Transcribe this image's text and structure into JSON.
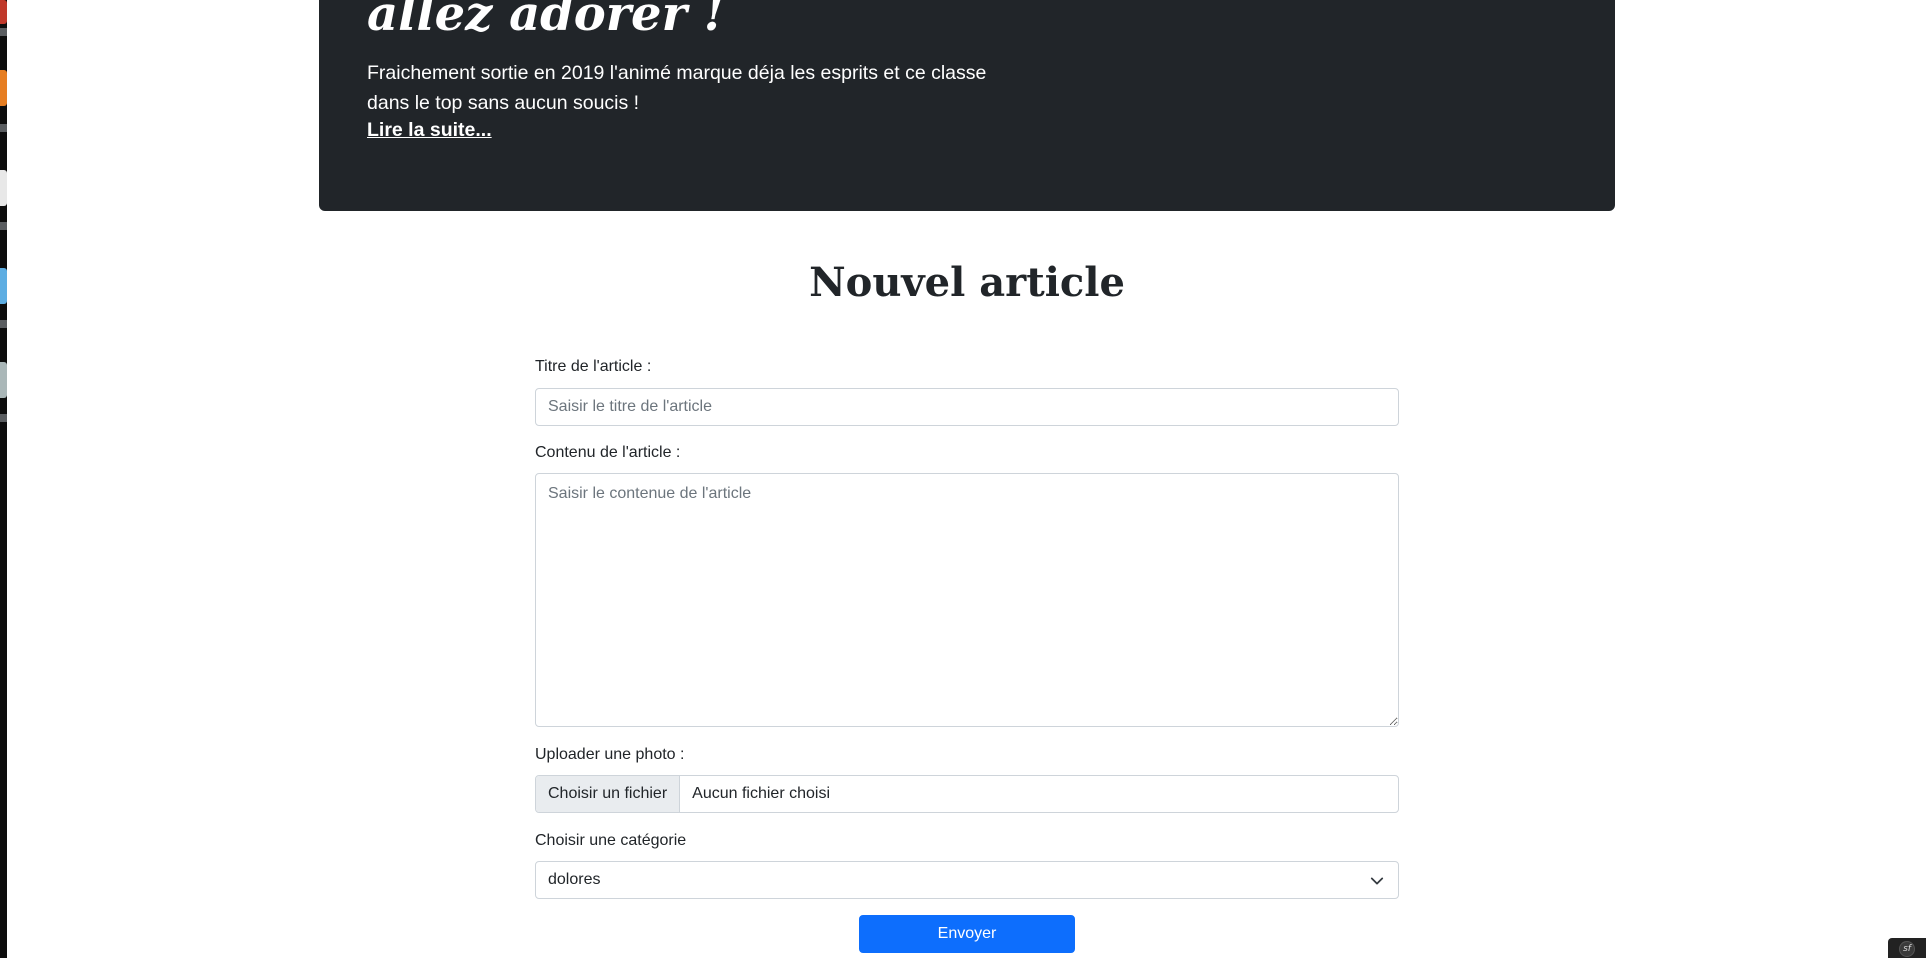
{
  "hero": {
    "title": "allez adorer !",
    "lead": "Fraichement sortie en 2019 l'animé marque déja les esprits et ce classe dans le top sans aucun soucis !",
    "link": "Lire la suite..."
  },
  "page_title": "Nouvel article",
  "form": {
    "title_label": "Titre de l'article :",
    "title_placeholder": "Saisir le titre de l'article",
    "content_label": "Contenu de l'article :",
    "content_placeholder": "Saisir le contenue de l'article",
    "photo_label": "Uploader une photo :",
    "file_button": "Choisir un fichier",
    "file_status": "Aucun fichier choisi",
    "category_label": "Choisir une catégorie",
    "category_selected": "dolores",
    "submit_label": "Envoyer"
  },
  "icons": {
    "select_arrow": "chevron-down-icon",
    "corner": "symfony-icon"
  },
  "colors": {
    "hero_bg": "#212529",
    "primary": "#0d6efd"
  }
}
